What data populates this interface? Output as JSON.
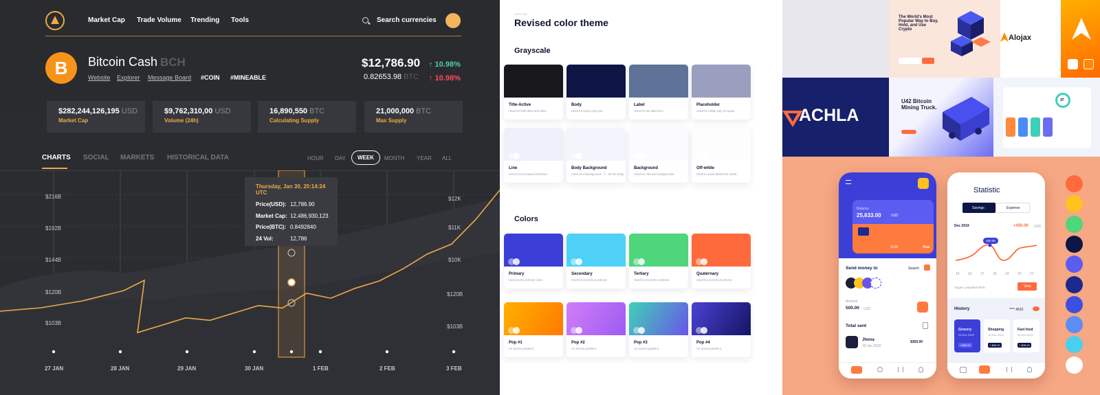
{
  "crypto": {
    "nav": [
      "Market Cap",
      "Trade Volume",
      "Trending",
      "Tools"
    ],
    "search_label": "Search currencies",
    "coin": {
      "name": "Bitcoin Cash",
      "symbol": "BCH",
      "glyph": "B"
    },
    "links": [
      "Website",
      "Explorer",
      "Message Board"
    ],
    "tags": [
      "#COIN",
      "#MINEABLE"
    ],
    "price_usd": "$12,786.90",
    "price_btc": "0.82653.98",
    "price_btc_unit": "BTC",
    "change_up": "↑ 10.98%",
    "change_down": "↑ 10.98%",
    "stats": [
      {
        "value": "$282,244,126,195",
        "unit": "USD",
        "label": "Market Cap"
      },
      {
        "value": "$9,762,310,00",
        "unit": "USD",
        "label": "Volume (24h)"
      },
      {
        "value": "16,890,550",
        "unit": "BTC",
        "label": "Calculating Supply"
      },
      {
        "value": "21,000,000",
        "unit": "BTC",
        "label": "Max Supply"
      }
    ],
    "tabs": [
      "CHARTS",
      "SOCIAL",
      "MARKETS",
      "HISTORICAL DATA"
    ],
    "ranges": [
      "HOUR",
      "DAY",
      "WEEK",
      "MONTH",
      "YEAR",
      "ALL"
    ],
    "tooltip": {
      "title": "Thursday, Jan 30, 20:14:24 UTC",
      "rows": [
        {
          "k": "Price(USD):",
          "v": "12,786.90"
        },
        {
          "k": "Market Cap:",
          "v": "12,486,930,123"
        },
        {
          "k": "Price(BTC):",
          "v": "0.8492840"
        },
        {
          "k": "24 Vol:",
          "v": "12,786"
        }
      ]
    },
    "colors": {
      "accent": "#f0a948",
      "up": "#4fd1a5",
      "down": "#ff4d5e",
      "bg": "#2b2c30"
    },
    "chart_data": {
      "type": "line",
      "x": [
        "27 JAN",
        "28 JAN",
        "29 JAN",
        "30 JAN",
        "1 FEB",
        "2 FEB",
        "3 FEB"
      ],
      "y_left_ticks": [
        "$216B",
        "$192B",
        "$144B",
        "$120B",
        "$103B"
      ],
      "y_right_ticks": [
        "$12K",
        "$11K",
        "$10K",
        "$120B",
        "$103B"
      ],
      "series": [
        {
          "values": [
            9.0,
            9.15,
            9.3,
            9.25,
            9.4,
            9.55,
            9.5,
            9.8,
            9.7,
            9.9,
            10.05,
            10.3,
            10.6,
            10.8,
            11.3,
            11.9
          ]
        }
      ],
      "ylim": [
        8.5,
        12.3
      ],
      "grid": true,
      "legend": "none"
    }
  },
  "theme": {
    "micro": "COLOR",
    "title": "Revised color theme",
    "grayscale_heading": "Grayscale",
    "colors_heading": "Colors",
    "grayscale": [
      {
        "name": "Title-Active",
        "desc": "Used for both titles and titles.",
        "color": "#17171c"
      },
      {
        "name": "Body",
        "desc": "Used for body copy text.",
        "color": "#0e1646"
      },
      {
        "name": "Label",
        "desc": "Used for the label text.",
        "color": "#5f7399"
      },
      {
        "name": "Placeholder",
        "desc": "Used for initial copy of inputs.",
        "color": "#9b9fbf"
      },
      {
        "name": "Line",
        "desc": "Used for line based elements.",
        "color": "#eef0fc"
      },
      {
        "name": "Body Background",
        "desc": "Used as a background... f... for the body... hash.",
        "color": "#f3f5fc"
      },
      {
        "name": "Background",
        "desc": "Used for element backgrounds.",
        "color": "#fbfbfd"
      },
      {
        "name": "Off-white",
        "desc": "Used to avoid darkmode strain.",
        "color": "#fdfdfe"
      }
    ],
    "palette": [
      {
        "name": "Primary",
        "desc": "Used as the primary color.",
        "color": "#3b3fd8"
      },
      {
        "name": "Secondary",
        "desc": "Used for accents & actions.",
        "color": "#4fd1f5"
      },
      {
        "name": "Tertiary",
        "desc": "Used for accents & actions.",
        "color": "#4fd57c"
      },
      {
        "name": "Quaternary",
        "desc": "Used for accents & actions.",
        "color": "#ff6a3d"
      },
      {
        "name": "Pop #1",
        "desc": "An accent gradient.",
        "color": "linear-gradient(120deg,#ffb000,#ff7a00)"
      },
      {
        "name": "Pop #2",
        "desc": "An accent gradient.",
        "color": "linear-gradient(120deg,#d07ef7,#9d5cf2)"
      },
      {
        "name": "Pop #3",
        "desc": "An accent gradient.",
        "color": "linear-gradient(120deg,#3fd0b7,#6a55e8)"
      },
      {
        "name": "Pop #4",
        "desc": "An accent gradient.",
        "color": "linear-gradient(120deg,#4b41d6,#141563)"
      }
    ]
  },
  "portfolio": {
    "hero_title": "The World's Most Popular Way to Buy, Hold, and Use Crypto",
    "mining_title": "U42 Bitcoin Mining Truck.",
    "brand_achla": "ACHLA",
    "brand_alojax": "Alojax",
    "dashboard_number": "37",
    "phone1": {
      "balance_label": "Balance",
      "balance": "25,633.00",
      "balance_unit": "USD",
      "card_tail": "1134",
      "card_brand": "Visa",
      "send_money": "Send money to",
      "search": "Search",
      "amount_label": "Amount",
      "amount": "500.00",
      "amount_unit": "USD",
      "total_sent": "Total sent",
      "recipient": "Jhona",
      "recipient_date": "03 Jan 2020",
      "recipient_amount": "$365.00"
    },
    "phone2": {
      "title": "Statistic",
      "tab_savings": "Savings",
      "tab_expense": "Expense",
      "month": "Dec 2019",
      "delta": "+450.00",
      "delta_unit": "USD",
      "peak": "400.00",
      "x_ticks": [
        "15",
        "16",
        "17",
        "18",
        "19",
        "20",
        "21"
      ],
      "target": "Target completed 90%",
      "view": "View",
      "history": "History",
      "card_mask": "**** 4533",
      "history_items": [
        {
          "name": "Grocery",
          "date": "25 Dec 2020",
          "amount": "+ $50.00"
        },
        {
          "name": "Shopping",
          "date": "10 Dec 2020",
          "amount": "+ $65.00"
        },
        {
          "name": "Fast food",
          "date": "16 Dec 2020",
          "amount": "+ $35.00"
        }
      ]
    },
    "dots": [
      "#ff6a3d",
      "#ffc21f",
      "#4fd57c",
      "#0e1646",
      "#5d5cf2",
      "#1b2a8c",
      "#3b50e0",
      "#5b8df5",
      "#49d0ef",
      "#ffffff"
    ]
  }
}
